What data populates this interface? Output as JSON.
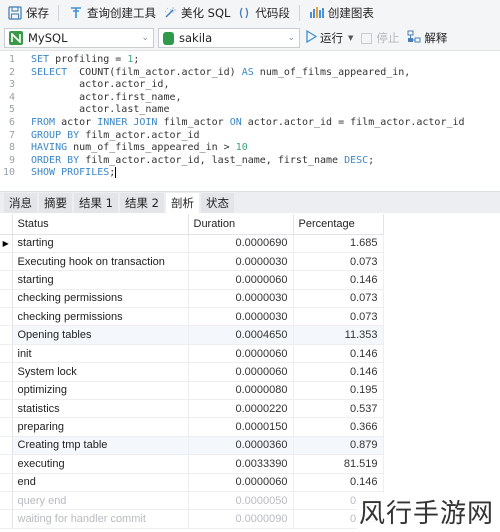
{
  "toolbar": {
    "save": "保存",
    "query_builder": "查询创建工具",
    "beautify_sql": "美化 SQL",
    "code_snippet": "代码段",
    "create_chart": "创建图表"
  },
  "selectors": {
    "connection": "MySQL",
    "database": "sakila",
    "run": "运行",
    "stop": "停止",
    "explain": "解释"
  },
  "editor": {
    "lines": [
      {
        "n": "1",
        "parts": [
          {
            "t": "kw",
            "v": "SET"
          },
          {
            "t": "txt",
            "v": " profiling = "
          },
          {
            "t": "num",
            "v": "1"
          },
          {
            "t": "txt",
            "v": ";"
          }
        ]
      },
      {
        "n": "2",
        "parts": [
          {
            "t": "kw",
            "v": "SELECT"
          },
          {
            "t": "txt",
            "v": "  COUNT(film_actor.actor_id) "
          },
          {
            "t": "kw",
            "v": "AS"
          },
          {
            "t": "txt",
            "v": " num_of_films_appeared_in,"
          }
        ]
      },
      {
        "n": "3",
        "parts": [
          {
            "t": "txt",
            "v": "        actor.actor_id,"
          }
        ]
      },
      {
        "n": "4",
        "parts": [
          {
            "t": "txt",
            "v": "        actor.first_name,"
          }
        ]
      },
      {
        "n": "5",
        "parts": [
          {
            "t": "txt",
            "v": "        actor.last_name"
          }
        ]
      },
      {
        "n": "6",
        "parts": [
          {
            "t": "kw",
            "v": "FROM"
          },
          {
            "t": "txt",
            "v": " actor "
          },
          {
            "t": "kw",
            "v": "INNER JOIN"
          },
          {
            "t": "txt",
            "v": " film_actor "
          },
          {
            "t": "kw",
            "v": "ON"
          },
          {
            "t": "txt",
            "v": " actor.actor_id = film_actor.actor_id"
          }
        ]
      },
      {
        "n": "7",
        "parts": [
          {
            "t": "kw",
            "v": "GROUP BY"
          },
          {
            "t": "txt",
            "v": " film_actor.actor_id"
          }
        ]
      },
      {
        "n": "8",
        "parts": [
          {
            "t": "kw",
            "v": "HAVING"
          },
          {
            "t": "txt",
            "v": " num_of_films_appeared_in > "
          },
          {
            "t": "num",
            "v": "10"
          }
        ]
      },
      {
        "n": "9",
        "parts": [
          {
            "t": "kw",
            "v": "ORDER BY"
          },
          {
            "t": "txt",
            "v": " film_actor.actor_id, last_name, first_name "
          },
          {
            "t": "kw",
            "v": "DESC"
          },
          {
            "t": "txt",
            "v": ";"
          }
        ]
      },
      {
        "n": "10",
        "parts": [
          {
            "t": "kw",
            "v": "SHOW PROFILES"
          },
          {
            "t": "txt",
            "v": ";"
          }
        ]
      }
    ]
  },
  "tabs": [
    {
      "label": "消息",
      "active": false
    },
    {
      "label": "摘要",
      "active": false
    },
    {
      "label": "结果 1",
      "active": false
    },
    {
      "label": "结果 2",
      "active": false
    },
    {
      "label": "剖析",
      "active": true
    },
    {
      "label": "状态",
      "active": false
    }
  ],
  "grid": {
    "columns": [
      "Status",
      "Duration",
      "Percentage"
    ],
    "rows": [
      {
        "status": "starting",
        "duration": "0.0000690",
        "percentage": "1.685",
        "current": true
      },
      {
        "status": "Executing hook on transaction",
        "duration": "0.0000030",
        "percentage": "0.073"
      },
      {
        "status": "starting",
        "duration": "0.0000060",
        "percentage": "0.146"
      },
      {
        "status": "checking permissions",
        "duration": "0.0000030",
        "percentage": "0.073"
      },
      {
        "status": "checking permissions",
        "duration": "0.0000030",
        "percentage": "0.073"
      },
      {
        "status": "Opening tables",
        "duration": "0.0004650",
        "percentage": "11.353",
        "highlight": true
      },
      {
        "status": "init",
        "duration": "0.0000060",
        "percentage": "0.146"
      },
      {
        "status": "System lock",
        "duration": "0.0000060",
        "percentage": "0.146"
      },
      {
        "status": "optimizing",
        "duration": "0.0000080",
        "percentage": "0.195"
      },
      {
        "status": "statistics",
        "duration": "0.0000220",
        "percentage": "0.537"
      },
      {
        "status": "preparing",
        "duration": "0.0000150",
        "percentage": "0.366"
      },
      {
        "status": "Creating tmp table",
        "duration": "0.0000360",
        "percentage": "0.879",
        "highlight": true
      },
      {
        "status": "executing",
        "duration": "0.0033390",
        "percentage": "81.519"
      },
      {
        "status": "end",
        "duration": "0.0000060",
        "percentage": "0.146"
      },
      {
        "status": "query end",
        "duration": "0.0000050",
        "percentage": "0.122",
        "faded": true
      },
      {
        "status": "waiting for handler commit",
        "duration": "0.0000090",
        "percentage": "0.220",
        "faded": true
      }
    ]
  },
  "watermark": "风行手游网"
}
